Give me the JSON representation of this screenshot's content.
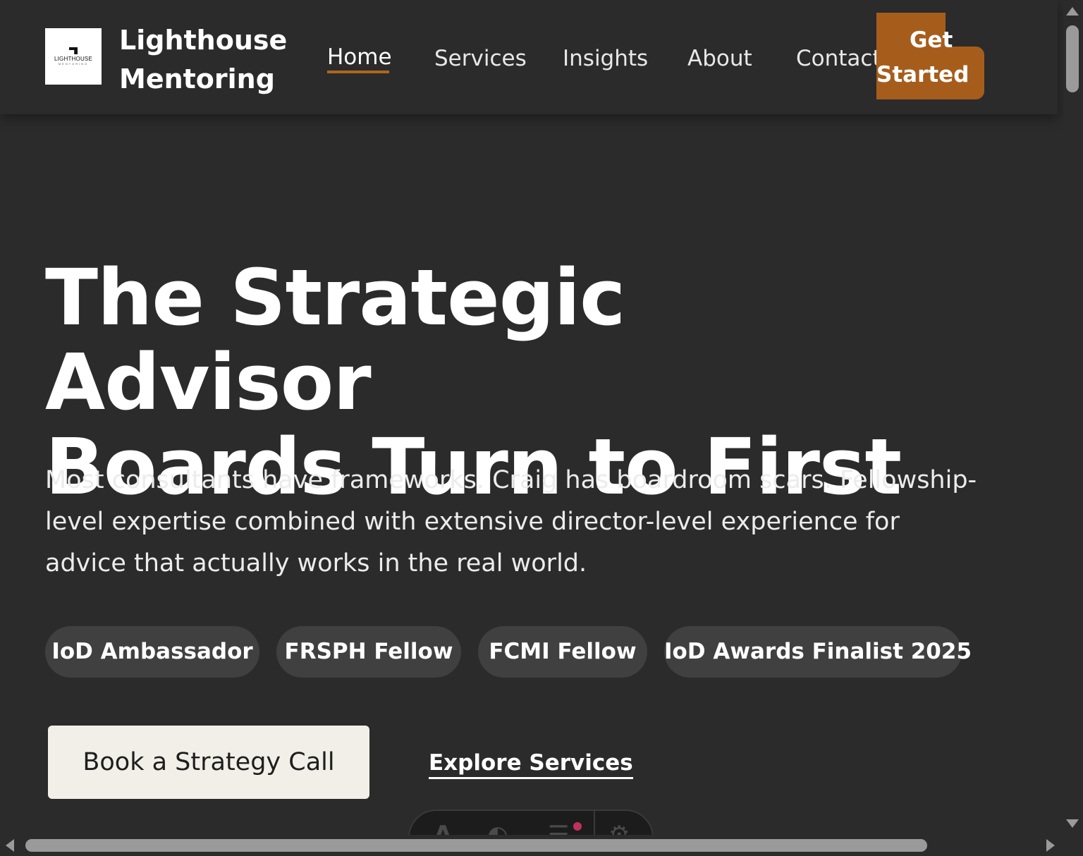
{
  "brand": {
    "logo_text": "LIGHTHOUSE",
    "logo_sub": "MENTORING",
    "name_line1": "Lighthouse",
    "name_line2": "Mentoring"
  },
  "nav": {
    "items": [
      {
        "label": "Home",
        "active": true
      },
      {
        "label": "Services"
      },
      {
        "label": "Insights"
      },
      {
        "label": "About"
      },
      {
        "label": "Contact"
      }
    ],
    "cta_line1": "Get",
    "cta_line2": "Started"
  },
  "hero": {
    "title_line1": "The Strategic Advisor",
    "title_line2": "Boards Turn to First",
    "text": "Most consultants have frameworks. Craig has boardroom scars. Fellowship-level expertise combined with extensive director-level experience for advice that actually works in the real world.",
    "badges": [
      "IoD Ambassador",
      "FRSPH Fellow",
      "FCMI Fellow",
      "IoD Awards Finalist 2025"
    ],
    "primary_button": "Book a Strategy Call",
    "secondary_link": "Explore Services"
  },
  "a11y_toolbar": {
    "icons": [
      "text-size-icon",
      "contrast-icon",
      "adjust-icon",
      "settings-icon"
    ],
    "notification_color": "#c0325a"
  },
  "colors": {
    "background": "#2b2b2b",
    "accent": "#a65d1c",
    "badge_bg": "#404040",
    "primary_button_bg": "#f2efe8"
  }
}
